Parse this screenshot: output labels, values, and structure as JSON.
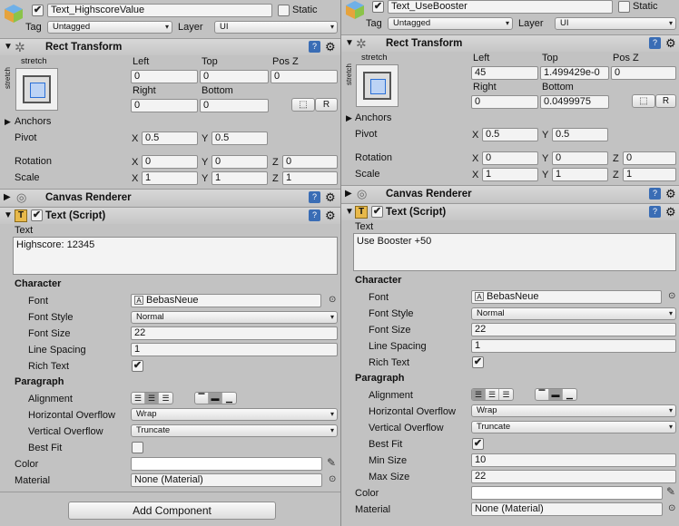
{
  "left": {
    "object": {
      "name": "Text_HighscoreValue",
      "static_label": "Static",
      "tag_label": "Tag",
      "tag_value": "Untagged",
      "layer_label": "Layer",
      "layer_value": "UI"
    },
    "rect": {
      "title": "Rect Transform",
      "stretch": "stretch",
      "stretch_side": "stretch",
      "left_label": "Left",
      "left_value": "0",
      "top_label": "Y",
      "top_value": "0",
      "posz_label": "Pos Z",
      "posz_value": "0",
      "right_label": "Right",
      "right_value": "0",
      "bottom_label": "Bottom",
      "bottom_value": "0",
      "top_label_text": "Top",
      "anchors_label": "Anchors",
      "pivot_label": "Pivot",
      "pivot_x": "0.5",
      "pivot_y": "0.5",
      "rotation_label": "Rotation",
      "rot_x": "0",
      "rot_y": "0",
      "rot_z": "0",
      "scale_label": "Scale",
      "scale_x": "1",
      "scale_y": "1",
      "scale_z": "1",
      "x_label": "X",
      "y_label": "Y",
      "z_label": "Z",
      "btn_r": "R"
    },
    "canvas": {
      "title": "Canvas Renderer"
    },
    "text": {
      "title": "Text (Script)",
      "text_label": "Text",
      "text_value": "Highscore: 12345",
      "character_label": "Character",
      "font_label": "Font",
      "font_value": "BebasNeue",
      "font_style_label": "Font Style",
      "font_style_value": "Normal",
      "font_size_label": "Font Size",
      "font_size_value": "22",
      "line_spacing_label": "Line Spacing",
      "line_spacing_value": "1",
      "rich_text_label": "Rich Text",
      "paragraph_label": "Paragraph",
      "alignment_label": "Alignment",
      "h_overflow_label": "Horizontal Overflow",
      "h_overflow_value": "Wrap",
      "v_overflow_label": "Vertical Overflow",
      "v_overflow_value": "Truncate",
      "best_fit_label": "Best Fit",
      "color_label": "Color",
      "material_label": "Material",
      "material_value": "None (Material)"
    },
    "add_component": "Add Component"
  },
  "right": {
    "object": {
      "name": "Text_UseBooster",
      "static_label": "Static",
      "tag_label": "Tag",
      "tag_value": "Untagged",
      "layer_label": "Layer",
      "layer_value": "UI"
    },
    "rect": {
      "title": "Rect Transform",
      "stretch": "stretch",
      "stretch_side": "stretch",
      "left_label": "Left",
      "left_value": "45",
      "top_label_text": "Top",
      "top_value": "1.499429e-0",
      "posz_label": "Pos Z",
      "posz_value": "0",
      "right_label": "Right",
      "right_value": "0",
      "bottom_label": "Bottom",
      "bottom_value": "0.0499975",
      "anchors_label": "Anchors",
      "pivot_label": "Pivot",
      "pivot_x": "0.5",
      "pivot_y": "0.5",
      "rotation_label": "Rotation",
      "rot_x": "0",
      "rot_y": "0",
      "rot_z": "0",
      "scale_label": "Scale",
      "scale_x": "1",
      "scale_y": "1",
      "scale_z": "1",
      "x_label": "X",
      "y_label": "Y",
      "z_label": "Z",
      "btn_r": "R"
    },
    "canvas": {
      "title": "Canvas Renderer"
    },
    "text": {
      "title": "Text (Script)",
      "text_label": "Text",
      "text_value": "Use Booster +50",
      "character_label": "Character",
      "font_label": "Font",
      "font_value": "BebasNeue",
      "font_style_label": "Font Style",
      "font_style_value": "Normal",
      "font_size_label": "Font Size",
      "font_size_value": "22",
      "line_spacing_label": "Line Spacing",
      "line_spacing_value": "1",
      "rich_text_label": "Rich Text",
      "paragraph_label": "Paragraph",
      "alignment_label": "Alignment",
      "h_overflow_label": "Horizontal Overflow",
      "h_overflow_value": "Wrap",
      "v_overflow_label": "Vertical Overflow",
      "v_overflow_value": "Truncate",
      "best_fit_label": "Best Fit",
      "min_size_label": "Min Size",
      "min_size_value": "10",
      "max_size_label": "Max Size",
      "max_size_value": "22",
      "color_label": "Color",
      "material_label": "Material",
      "material_value": "None (Material)"
    }
  },
  "icons": {
    "gameobject": "cube-icon",
    "rect": "rect-transform-icon",
    "canvas": "canvas-renderer-icon",
    "text": "text-component-icon",
    "help": "help-book-icon",
    "gear": "gear-icon",
    "picker": "eyedropper-icon"
  }
}
